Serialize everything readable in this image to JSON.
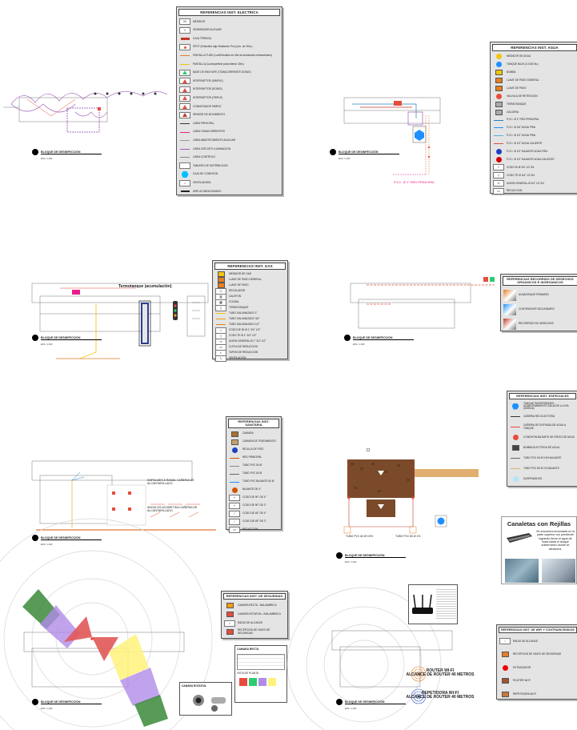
{
  "blocks": {
    "title": "BLOQUE DE DESINFECCIÓN",
    "scale": "ESC: 1:100"
  },
  "electrica": {
    "title": "REFERENCIAS INST. ELECTRICA",
    "items": [
      "MEDIDOR",
      "GENERADOR AUXILIAR",
      "CAJA TÉRMICA",
      "SPOT (Embutido bajo Radiación Proc) (en. de 30m.)",
      "PANTALLA TUBO (Luz/Embutido en Mts de alumbrado extraordinario)",
      "PANTALLA (Luz/superficie para interior 30m.)",
      "BASE DE ENCHUFE (TOMACORRIENTE DOBLE)",
      "INTERRUPTOR (SIMPLE)",
      "INTERRUPTOR (DOBLE)",
      "INTERRUPTOR (TRIPLE)",
      "CONMUTADOR SIMPLE",
      "SENSOR DE MOVIMIENTO",
      "LINEA PRINCIPAL",
      "LINEA TOMACORRIENTES",
      "LINEA ABASTECIMIENTO AUXILIAR",
      "LINEA CIRCUITO ILUMINACION",
      "LINEA CONTROLO",
      "TABLERO DE DISTRIBUCION",
      "CAJA DE CONEXION",
      "VENTILADORA",
      "AIRE ACONDICIONADO"
    ]
  },
  "agua": {
    "title": "REFERENCIAS INST. AGUA",
    "items": [
      "MEDIDOR DE AGUA",
      "TANQUE BAJO (4.1000 lts.)",
      "BOMBA",
      "LLAVE DE PASO GENERAL",
      "LLAVE DE PASO",
      "VALVULA DE RETENCION",
      "TERMOTANQUE",
      "CALDERA",
      "P.V.C. Ø 1\" RED PRINCIPAL",
      "P.V.C. Ø 3/4\" AGUA FRIA",
      "P.V.C. Ø 1/2\" AGUA FRIA",
      "P.V.C. Ø 1/2\" AGUA CALIENTE",
      "P.V.C. Ø 1/2\" BAJANTE AGUA FRIA",
      "P.V.C. Ø 1/2\" BAJANTE AGUA CALIENTE",
      "CODO 90 Ø 3/4\" 1/2 3/4",
      "CODO TE Ø 3/4\" 1/2 3/4",
      "UNION GENERAL Ø 3/4\" 1/2 3/4",
      "REDUCCION"
    ],
    "pipe_label": "P.V.C. Ø 1\" RED PRINCIPAL"
  },
  "gas": {
    "title": "REFERENCIAS INST. GAS",
    "subtitle": "Termotanque (acumulación)",
    "items": [
      "MEDIDOR DE GAS",
      "LLAVE DE PASO GENERAL",
      "LLAVE DE PASO",
      "REGULADOR",
      "CALEFON",
      "COCINA",
      "TERMOTANQUE",
      "TUBO GALVANIZADO 1\"",
      "TUBO GALVANIZADO 3/4\"",
      "TUBO GALVANIZADO 1/2\"",
      "CODO DE 90 Ø 1\" 3/4\" 1/2\"",
      "CODO TE Ø 1\" 3/4\" 1/2\"",
      "UNION GENERAL Ø 1\" 3/4\" 1/2\"",
      "CUPLA DE REDUCCION",
      "TAPON DE REDUCCION",
      "VENTILACION"
    ]
  },
  "desechos": {
    "title": "REFERENCIAS RECORRIDO DE DESECHOS ORGANICOS E INORGANICOS",
    "items": [
      "ALMACENAJE PRIMARIO",
      "CONTENEDOR SECUNDARIO",
      "RECORRIDO DE DESECHOS"
    ]
  },
  "sanitaria": {
    "title": "REFERENCIAS INST. SANITARIA",
    "notes": [
      "EMPALMES A RAMAL CAÑERIA DE ALCANTARILLADO",
      "ANGULOS ACOMETIDA CAÑERIA DE ALCANTARILLADO"
    ],
    "items": [
      "CAMARA",
      "CAMARA DE TRATAMIENTO",
      "REJILLA DE PISO",
      "RED PRINCIPAL",
      "TUBO PVC 50 Ø",
      "TUBO PVC 60 Ø",
      "TUBO PVC BAJANTE 60 Ø",
      "BAJANTE DE 4\"",
      "CODO DE 90° DE 4\"",
      "CODO DE 90° DE 2\"",
      "CODO DE 45° DE 4\"",
      "CODO DE 45° DE 2\"",
      "REDUCCION"
    ]
  },
  "especiales": {
    "title": "REFERENCIAS INST. ESPECIALES",
    "items": [
      "TANQUE SUBTERRANEO - ALMACENAMIENTO AGUA DE LLUVIA (4000Lts)",
      "CAÑERIA RECOLECTORA",
      "CAÑERIA DE ENTRADA DE AGUA A TANQUE",
      "CONEXIÓN BAJANTE DE RIEGO DE AGUA",
      "BOMBA ELECTRICA DE AGUA",
      "TUBO PVC 60 Ø 0.5% BAJANTE",
      "TUBO PVC 80 Ø 1% BAJANTE",
      "SUSPENDIDOS"
    ],
    "pipe_labels": [
      "TUBO PVC 60 Ø 0.5%",
      "TUBO PVC 80 Ø 1%"
    ]
  },
  "canaletas": {
    "title": "Canaletas con Rejillas",
    "text": "Se encuentra incrustada en la parte superior con pendiente logrando llevar el agua de lluvia hasta el tanque subterráneo donde se almacena."
  },
  "seguridad": {
    "title": "REFERENCIAS INST. DE SEGURIDAD",
    "items": [
      "CAMARA RECTA - MALAMBRICA",
      "CAMARA ROTATIVA - INALAMBRICA",
      "RADIO DE ALCANCE",
      "RECEPCION DE VIDEO DE SEGURIDAD"
    ],
    "camera_label": "CAMARA RECTA",
    "rot_label": "CAMARA ROTATIVA",
    "plan_label": "VISTA DE PLANTA"
  },
  "wifi": {
    "title": "REFERENCIAS INST. DE WIFI Y CONTRAINCENDIOS",
    "items": [
      "RADIO DE ALCANCE",
      "RECEPCION DE VIDEO DE SEGURIDAD",
      "EXTINGUIDOR",
      "ROUTER WI-FI",
      "REPETIDORA WI-FI"
    ],
    "router_label": "ROUTER WI-FI\nALCANCE DE ROUTER 40 METROS",
    "repeater_label": "REPETIDORA WI-FI\nALCANCE DE ROUTER 40 METROS"
  }
}
